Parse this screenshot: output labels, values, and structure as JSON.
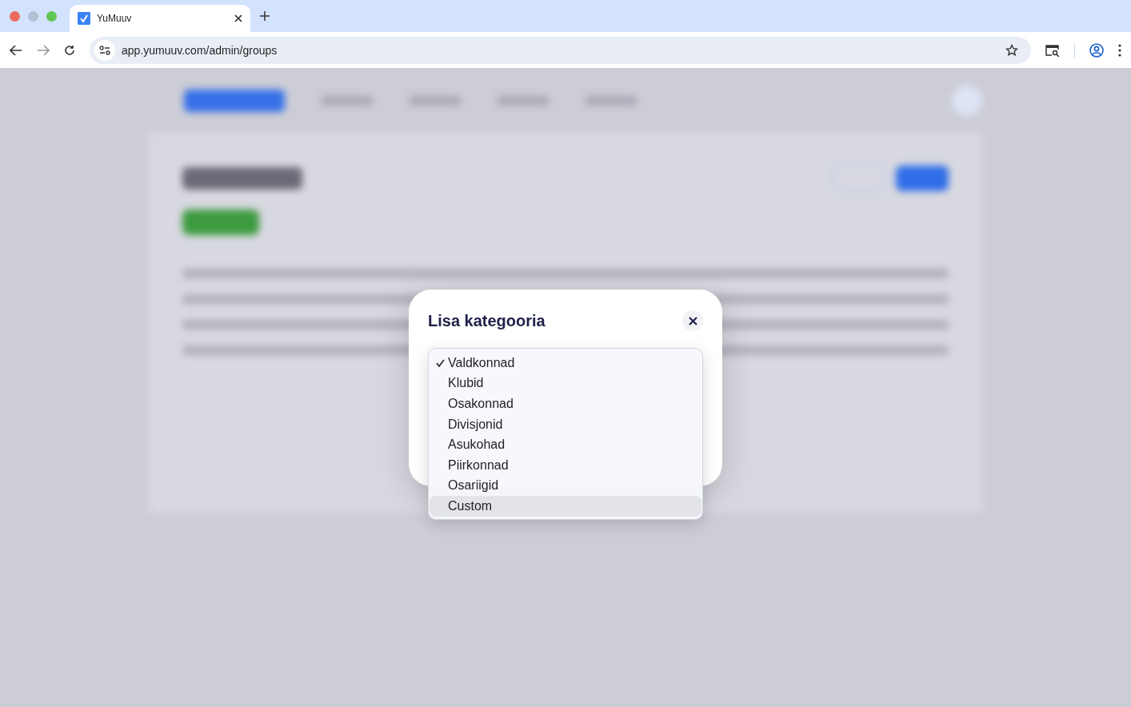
{
  "browser": {
    "tab_title": "YuMuuv",
    "url": "app.yumuuv.com/admin/groups"
  },
  "dialog": {
    "title": "Lisa kategooria",
    "options": [
      {
        "label": "Valdkonnad",
        "selected": true,
        "highlighted": false
      },
      {
        "label": "Klubid",
        "selected": false,
        "highlighted": false
      },
      {
        "label": "Osakonnad",
        "selected": false,
        "highlighted": false
      },
      {
        "label": "Divisjonid",
        "selected": false,
        "highlighted": false
      },
      {
        "label": "Asukohad",
        "selected": false,
        "highlighted": false
      },
      {
        "label": "Piirkonnad",
        "selected": false,
        "highlighted": false
      },
      {
        "label": "Osariigid",
        "selected": false,
        "highlighted": false
      },
      {
        "label": "Custom",
        "selected": false,
        "highlighted": true
      }
    ]
  }
}
